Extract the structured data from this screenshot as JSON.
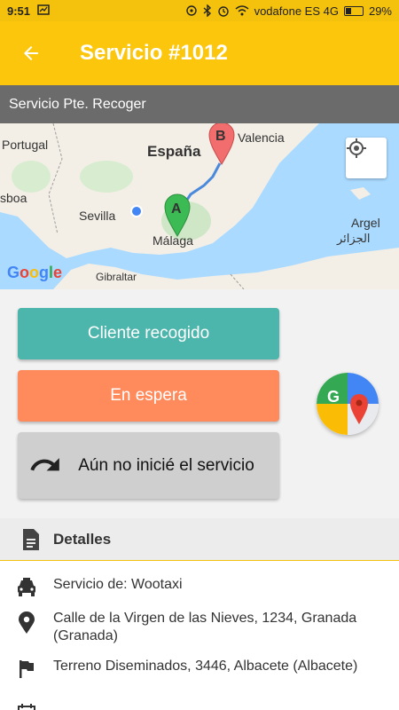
{
  "status_bar": {
    "time": "9:51",
    "carrier": "vodafone ES 4G",
    "battery": "29%",
    "battery_level": 0.29
  },
  "app_bar": {
    "back_icon": "arrow-back-icon",
    "title": "Servicio #1012"
  },
  "sub_bar": {
    "status": "Servicio Pte. Recoger"
  },
  "map": {
    "labels": {
      "portugal": "Portugal",
      "espana": "España",
      "valencia": "Valencia",
      "lisboa": "sboa",
      "sevilla": "Sevilla",
      "malaga": "Málaga",
      "argel": "Argel",
      "argel_ar": "الجزائر",
      "gibraltar": "Gibraltar"
    },
    "marker_a": "A",
    "marker_b": "B",
    "google": "Google",
    "locate_icon": "my-location-icon",
    "colors": {
      "route": "#4a89dc",
      "marker_a": "#3cba54",
      "marker_b": "#f26d6d"
    }
  },
  "actions": {
    "picked_up": "Cliente recogido",
    "waiting": "En espera",
    "not_started": "Aún no inicié el servicio",
    "undo_icon": "undo-icon",
    "gmaps_icon": "google-maps-icon",
    "colors": {
      "picked_up": "#4db6ac",
      "waiting": "#ff8a5c",
      "not_started": "#cfcfcf"
    }
  },
  "details": {
    "header": "Detalles",
    "header_icon": "document-icon",
    "items": [
      {
        "icon": "taxi-icon",
        "text": "Servicio de: Wootaxi"
      },
      {
        "icon": "location-pin-icon",
        "text": "Calle de la Virgen de las Nieves, 1234, Granada (Granada)"
      },
      {
        "icon": "flag-icon",
        "text": "Terreno Diseminados, 3446, Albacete (Albacete)"
      }
    ]
  }
}
